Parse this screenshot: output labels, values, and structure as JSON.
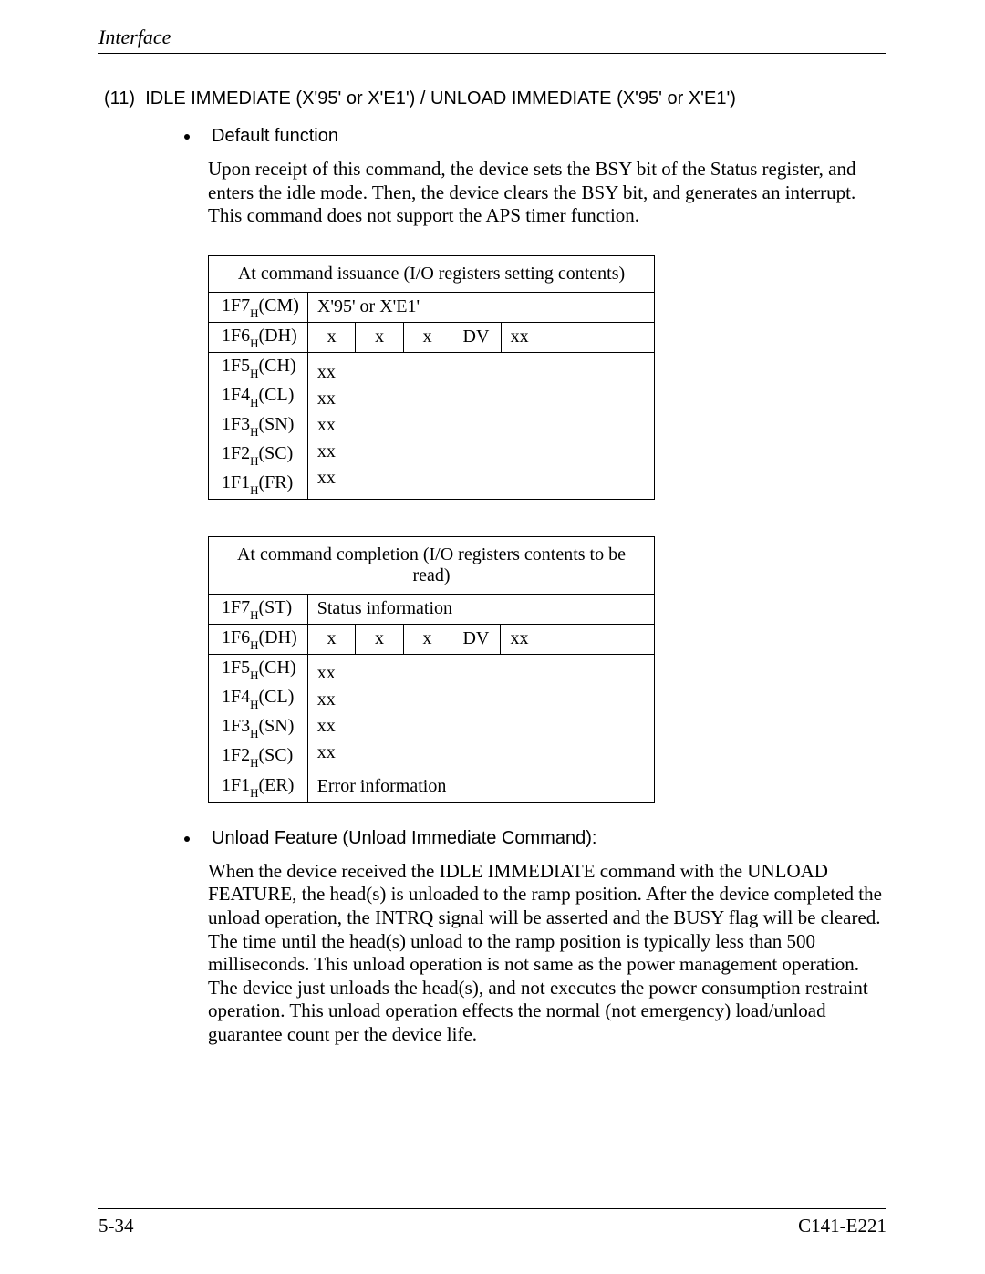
{
  "running_head": "Interface",
  "section": {
    "number": "(11)",
    "title": "IDLE IMMEDIATE (X'95' or X'E1') / UNLOAD IMMEDIATE (X'95' or X'E1')"
  },
  "bullets": {
    "b1_title": "Default function",
    "b1_text": "Upon receipt of this command, the device sets the BSY bit of the Status register, and enters the idle mode. Then, the device clears the BSY bit, and generates an interrupt. This command does not support the APS timer function.",
    "b2_title": "Unload Feature (Unload Immediate Command):",
    "b2_text": "When the device received the IDLE IMMEDIATE command with the UNLOAD FEATURE, the head(s) is unloaded to the ramp position. After the device completed the unload operation, the INTRQ signal will be asserted and the BUSY flag will be cleared. The time until the head(s) unload to the ramp position is typically less than 500 milliseconds. This unload operation is not same as the power management operation. The device just unloads the head(s), and not executes the power consumption restraint operation. This unload operation effects the normal (not emergency) load/unload guarantee count per the device life."
  },
  "table1": {
    "title": "At command issuance (I/O registers setting contents)",
    "r1_label_base": "1F7",
    "r1_label_sub": "H",
    "r1_label_suffix": "(CM)",
    "r1_value": "X'95' or X'E1'",
    "r2_label_base": "1F6",
    "r2_label_sub": "H",
    "r2_label_suffix": "(DH)",
    "r2_b1": "x",
    "r2_b2": "x",
    "r2_b3": "x",
    "r2_b4": "DV",
    "r2_b5": "xx",
    "stack_labels": {
      "l3_base": "1F5",
      "l3_sub": "H",
      "l3_suffix": "(CH)",
      "l4_base": "1F4",
      "l4_sub": "H",
      "l4_suffix": "(CL)",
      "l5_base": "1F3",
      "l5_sub": "H",
      "l5_suffix": "(SN)",
      "l6_base": "1F2",
      "l6_sub": "H",
      "l6_suffix": "(SC)",
      "l7_base": "1F1",
      "l7_sub": "H",
      "l7_suffix": "(FR)"
    },
    "stack_values": {
      "v3": "xx",
      "v4": "xx",
      "v5": "xx",
      "v6": "xx",
      "v7": "xx"
    }
  },
  "table2": {
    "title": "At command completion (I/O registers contents to be read)",
    "r1_label_base": "1F7",
    "r1_label_sub": "H",
    "r1_label_suffix": "(ST)",
    "r1_value": "Status information",
    "r2_label_base": "1F6",
    "r2_label_sub": "H",
    "r2_label_suffix": "(DH)",
    "r2_b1": "x",
    "r2_b2": "x",
    "r2_b3": "x",
    "r2_b4": "DV",
    "r2_b5": "xx",
    "stack_labels": {
      "l3_base": "1F5",
      "l3_sub": "H",
      "l3_suffix": "(CH)",
      "l4_base": "1F4",
      "l4_sub": "H",
      "l4_suffix": "(CL)",
      "l5_base": "1F3",
      "l5_sub": "H",
      "l5_suffix": "(SN)",
      "l6_base": "1F2",
      "l6_sub": "H",
      "l6_suffix": "(SC)"
    },
    "stack_values": {
      "v3": "xx",
      "v4": "xx",
      "v5": "xx",
      "v6": "xx"
    },
    "r7_label_base": "1F1",
    "r7_label_sub": "H",
    "r7_label_suffix": "(ER)",
    "r7_value": "Error information"
  },
  "footer": {
    "page": "5-34",
    "doc": "C141-E221"
  }
}
